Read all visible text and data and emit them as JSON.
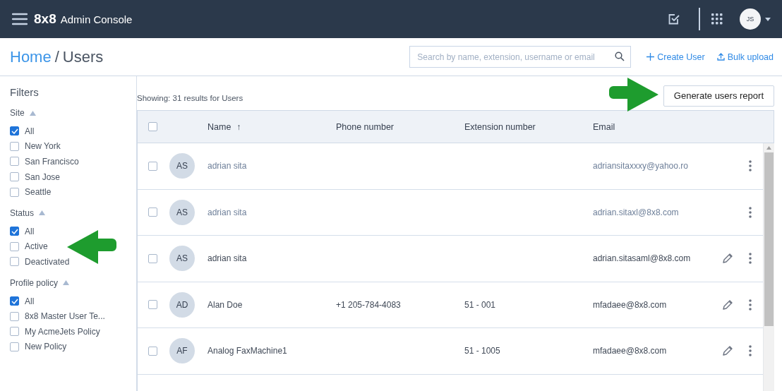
{
  "header": {
    "logo": "8x8",
    "title": "Admin Console",
    "avatar": "JS"
  },
  "breadcrumb": {
    "home": "Home",
    "separator": "/",
    "current": "Users"
  },
  "search": {
    "placeholder": "Search by name, extension, username or email"
  },
  "actions": [
    {
      "label": "Create User",
      "kind": "plus"
    },
    {
      "label": "Bulk upload",
      "kind": "upload"
    }
  ],
  "filters": {
    "title": "Filters",
    "groups": [
      {
        "title": "Site",
        "expanded": true,
        "options": [
          {
            "label": "All",
            "checked": true
          },
          {
            "label": "New York",
            "checked": false
          },
          {
            "label": "San Francisco",
            "checked": false
          },
          {
            "label": "San Jose",
            "checked": false
          },
          {
            "label": "Seattle",
            "checked": false
          }
        ]
      },
      {
        "title": "Status",
        "expanded": true,
        "options": [
          {
            "label": "All",
            "checked": true
          },
          {
            "label": "Active",
            "checked": false
          },
          {
            "label": "Deactivated",
            "checked": false
          }
        ]
      },
      {
        "title": "Profile policy",
        "expanded": true,
        "options": [
          {
            "label": "All",
            "checked": true
          },
          {
            "label": "8x8 Master User Te...",
            "checked": false
          },
          {
            "label": "My AcmeJets Policy",
            "checked": false
          },
          {
            "label": "New Policy",
            "checked": false
          }
        ]
      }
    ]
  },
  "results": "Showing: 31 results for Users",
  "report_button": "Generate users report",
  "table": {
    "select_all_checked": false,
    "columns": [
      {
        "label": "Name",
        "sorted": true,
        "sort_icon": "↑"
      },
      {
        "label": "Phone number",
        "sorted": false
      },
      {
        "label": "Extension number",
        "sorted": false
      },
      {
        "label": "Email",
        "sorted": false
      }
    ],
    "rows": [
      {
        "initials": "AS",
        "name": "adrian sita",
        "email": "adriansitaxxxy@yahoo.ro",
        "editable": false,
        "checked": false
      },
      {
        "initials": "AS",
        "name": "adrian sita",
        "email": "adrian.sitaxl@8x8.com",
        "editable": false,
        "checked": false
      },
      {
        "initials": "AS",
        "name": "adrian sita",
        "email": "adrian.sitasaml@8x8.com",
        "editable": true,
        "checked": false
      },
      {
        "initials": "AD",
        "name": "Alan Doe",
        "phone": "+1 205-784-4083",
        "extension": "51 - 001",
        "email": "mfadaee@8x8.com",
        "editable": true,
        "checked": false
      },
      {
        "initials": "AF",
        "name": "Analog FaxMachine1",
        "extension": "51 - 1005",
        "email": "mfadaee@8x8.com",
        "editable": true,
        "checked": false
      }
    ]
  }
}
